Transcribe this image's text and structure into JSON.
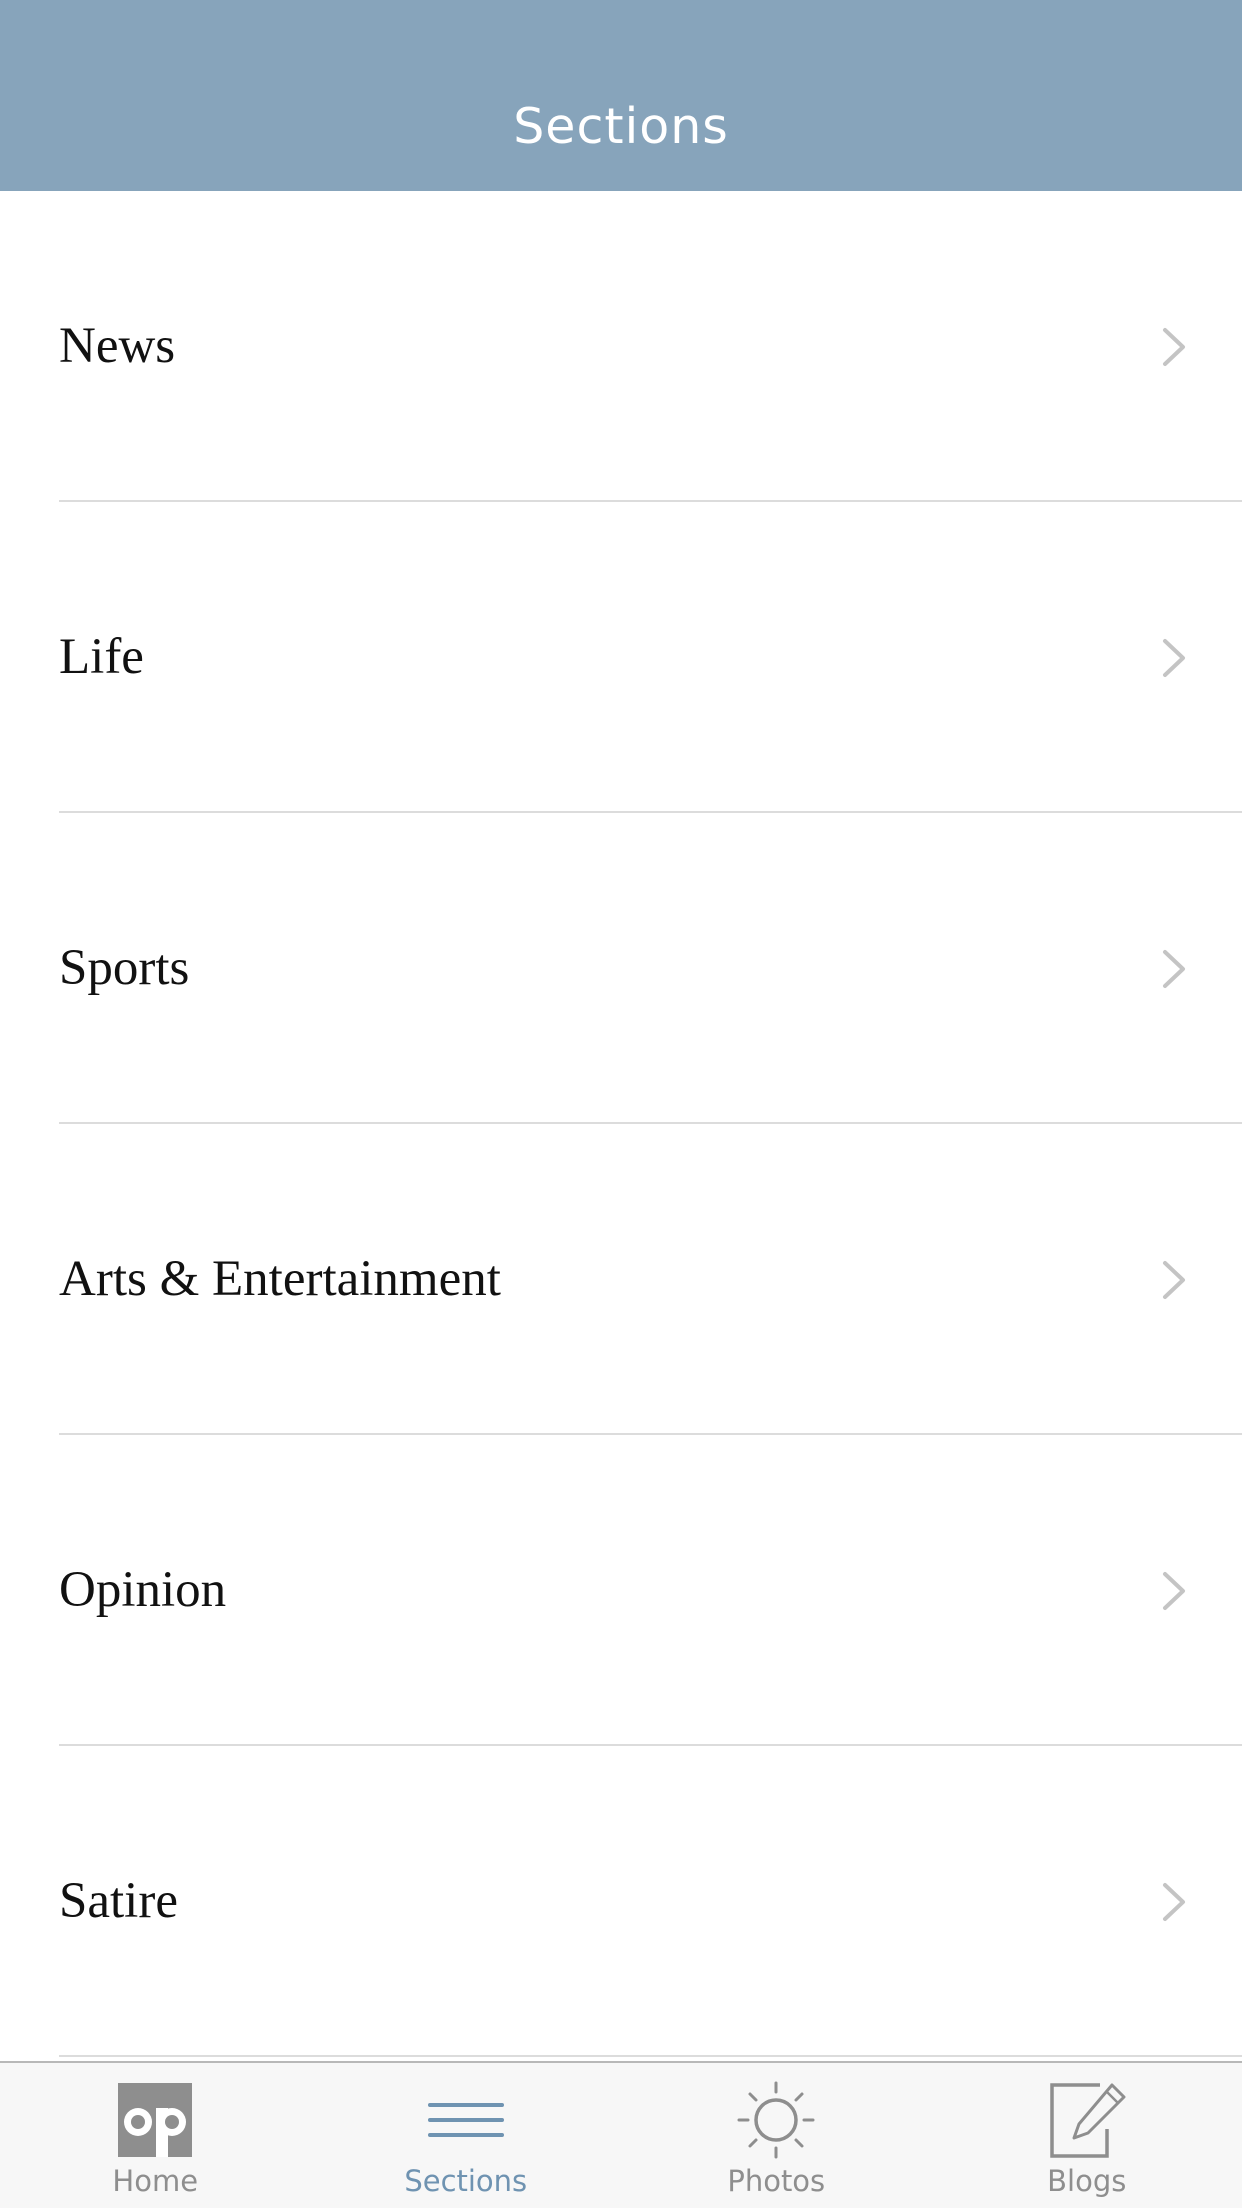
{
  "header": {
    "title": "Sections"
  },
  "sections": [
    {
      "label": "News"
    },
    {
      "label": "Life"
    },
    {
      "label": "Sports"
    },
    {
      "label": "Arts & Entertainment"
    },
    {
      "label": "Opinion"
    },
    {
      "label": "Satire"
    }
  ],
  "tab_bar": {
    "active_tab": "Sections",
    "tabs": [
      {
        "label": "Home",
        "icon": "op-logo-icon"
      },
      {
        "label": "Sections",
        "icon": "hamburger-icon"
      },
      {
        "label": "Photos",
        "icon": "sun-icon"
      },
      {
        "label": "Blogs",
        "icon": "pencil-square-icon"
      }
    ]
  },
  "colors": {
    "header_background": "#87a4bb",
    "active_tab": "#6f93b1",
    "inactive_tab": "#8e8e8e"
  }
}
